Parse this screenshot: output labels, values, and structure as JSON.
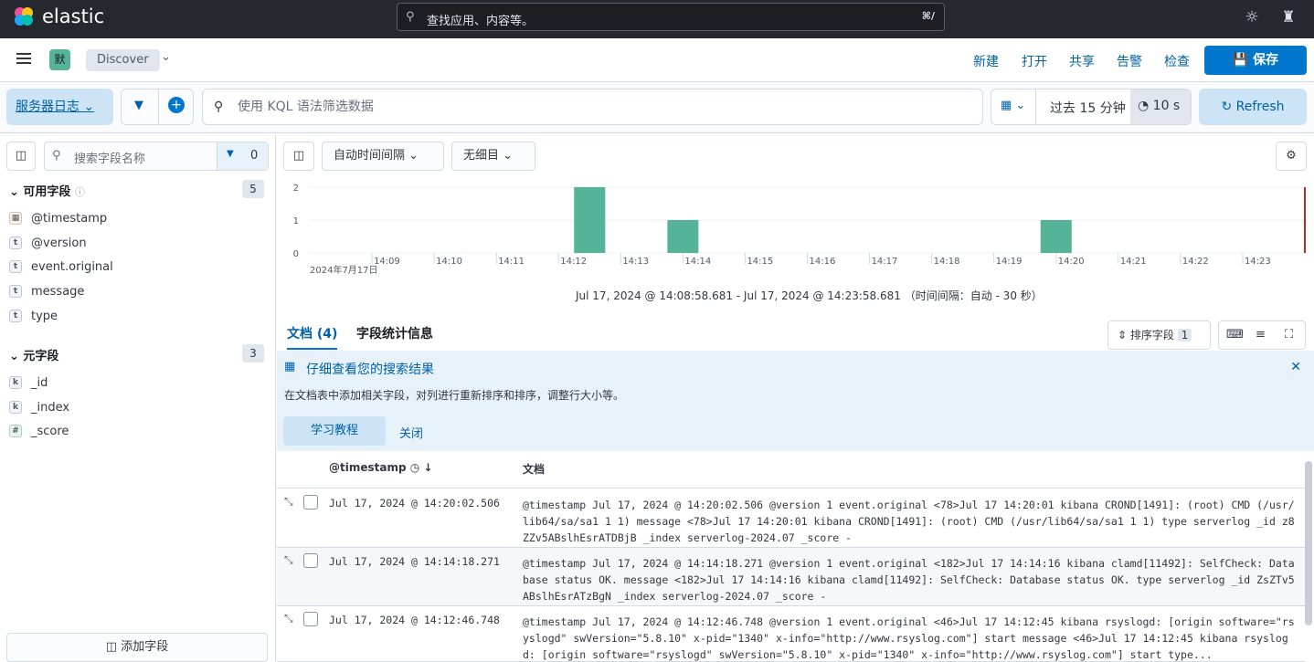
{
  "app": {
    "name": "elastic",
    "search_placeholder": "查找应用、内容等。",
    "shortcut": "⌘/"
  },
  "header": {
    "space_initial": "默",
    "breadcrumb": "Discover",
    "menu": [
      "新建",
      "打开",
      "共享",
      "告警",
      "检查"
    ],
    "save": "保存"
  },
  "query": {
    "data_view": "服务器日志",
    "kql_placeholder": "使用 KQL 语法筛选数据",
    "time_range": "过去 15 分钟",
    "refresh_interval": "10 s",
    "refresh": "Refresh"
  },
  "sidebar": {
    "search_placeholder": "搜索字段名称",
    "filter_count": "0",
    "available": {
      "title": "可用字段",
      "count": "5",
      "fields": [
        {
          "name": "@timestamp",
          "type": "date"
        },
        {
          "name": "@version",
          "type": "t"
        },
        {
          "name": "event.original",
          "type": "t"
        },
        {
          "name": "message",
          "type": "t"
        },
        {
          "name": "type",
          "type": "t"
        }
      ]
    },
    "meta": {
      "title": "元字段",
      "count": "3",
      "fields": [
        {
          "name": "_id",
          "type": "k"
        },
        {
          "name": "_index",
          "type": "k"
        },
        {
          "name": "_score",
          "type": "#"
        }
      ]
    },
    "add_field": "添加字段"
  },
  "histogram": {
    "interval": "自动时间间隔",
    "breakdown": "无细目",
    "range_text": "Jul 17, 2024 @ 14:08:58.681 - Jul 17, 2024 @ 14:23:58.681 （时间间隔：自动 - 30 秒）",
    "date_label": "2024年7月17日"
  },
  "chart_data": {
    "type": "bar",
    "x": [
      "14:12:30",
      "14:14:00",
      "14:20:00"
    ],
    "values": [
      2,
      1,
      1
    ],
    "x_ticks": [
      "14:09",
      "14:10",
      "14:11",
      "14:12",
      "14:13",
      "14:14",
      "14:15",
      "14:16",
      "14:17",
      "14:18",
      "14:19",
      "14:20",
      "14:21",
      "14:22",
      "14:23"
    ],
    "y_ticks": [
      "0",
      "1",
      "2"
    ],
    "ylim": [
      0,
      2
    ],
    "color": "#54b399"
  },
  "tabs": {
    "documents": "文档 (4)",
    "field_stats": "字段统计信息",
    "sort_label": "排序字段",
    "sort_count": "1"
  },
  "callout": {
    "title": "仔细查看您的搜索结果",
    "body": "在文档表中添加相关字段，对列进行重新排序和排序，调整行大小等。",
    "learn": "学习教程",
    "close": "关闭"
  },
  "table": {
    "col_timestamp": "@timestamp",
    "col_doc": "文档",
    "rows": [
      {
        "ts": "Jul 17, 2024 @ 14:20:02.506",
        "doc": "@timestamp Jul 17, 2024 @ 14:20:02.506 @version 1 event.original <78>Jul 17 14:20:01 kibana CROND[1491]: (root) CMD (/usr/lib64/sa/sa1 1 1) message <78>Jul 17 14:20:01 kibana CROND[1491]: (root) CMD (/usr/lib64/sa/sa1 1 1) type serverlog _id z8ZZv5ABslhEsrATDBjB _index serverlog-2024.07 _score -"
      },
      {
        "ts": "Jul 17, 2024 @ 14:14:18.271",
        "doc": "@timestamp Jul 17, 2024 @ 14:14:18.271 @version 1 event.original <182>Jul 17 14:14:16 kibana clamd[11492]: SelfCheck: Database status OK. message <182>Jul 17 14:14:16 kibana clamd[11492]: SelfCheck: Database status OK. type serverlog _id ZsZTv5ABslhEsrATzBgN _index serverlog-2024.07 _score -"
      },
      {
        "ts": "Jul 17, 2024 @ 14:12:46.748",
        "doc": "@timestamp Jul 17, 2024 @ 14:12:46.748 @version 1 event.original <46>Jul 17 14:12:45 kibana rsyslogd: [origin software=\"rsyslogd\" swVersion=\"5.8.10\" x-pid=\"1340\" x-info=\"http://www.rsyslog.com\"] start message <46>Jul 17 14:12:45 kibana rsyslogd: [origin software=\"rsyslogd\" swVersion=\"5.8.10\" x-pid=\"1340\" x-info=\"http://www.rsyslog.com\"] start type..."
      }
    ]
  }
}
